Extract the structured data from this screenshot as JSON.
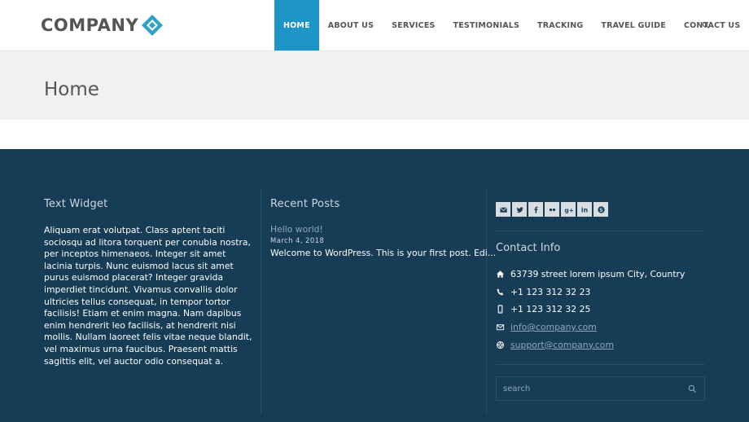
{
  "header": {
    "logo_text": "COMPANY",
    "nav": [
      {
        "label": "HOME",
        "active": true
      },
      {
        "label": "ABOUT US"
      },
      {
        "label": "SERVICES"
      },
      {
        "label": "TESTIMONIALS"
      },
      {
        "label": "TRACKING"
      },
      {
        "label": "TRAVEL GUIDE"
      },
      {
        "label": "CONTACT US"
      }
    ],
    "search_icon": "search-icon"
  },
  "title_band": {
    "title": "Home"
  },
  "footer": {
    "text_widget": {
      "title": "Text Widget",
      "body": "Aliquam erat volutpat. Class aptent taciti sociosqu ad litora torquent per conubia nostra, per inceptos himenaeos. Integer sit amet lacinia turpis. Nunc euismod lacus sit amet purus euismod placerat? Integer gravida imperdiet tincidunt. Vivamus convallis dolor ultricies tellus consequat, in tempor tortor facilisis! Etiam et enim magna. Nam dapibus enim hendrerit leo facilisis, at hendrerit nisi mollis. Nullam laoreet felis vitae neque blandit, vel maximus urna faucibus. Praesent mattis sagittis elit, vel auctor odio consequat a."
    },
    "recent_posts": {
      "title": "Recent Posts",
      "post_title": "Hello world!",
      "post_date": "March 4, 2018",
      "post_excerpt": "Welcome to WordPress. This is your first post. Edi..."
    },
    "contact": {
      "social_icons": [
        "mail-icon",
        "twitter-icon",
        "facebook-icon",
        "flickr-icon",
        "googleplus-icon",
        "linkedin-icon",
        "skype-icon"
      ],
      "title": "Contact Info",
      "address": "63739 street lorem ipsum City, Country",
      "phone": "+1 123 312 32 23",
      "mobile": "+1 123 312 32 25",
      "email": "info@company.com",
      "support": "support@company.com",
      "search_placeholder": "search"
    }
  },
  "colors": {
    "accent": "#1d95c6",
    "footer_bg": "#173c56",
    "title_band_bg": "#f1f1f1"
  }
}
